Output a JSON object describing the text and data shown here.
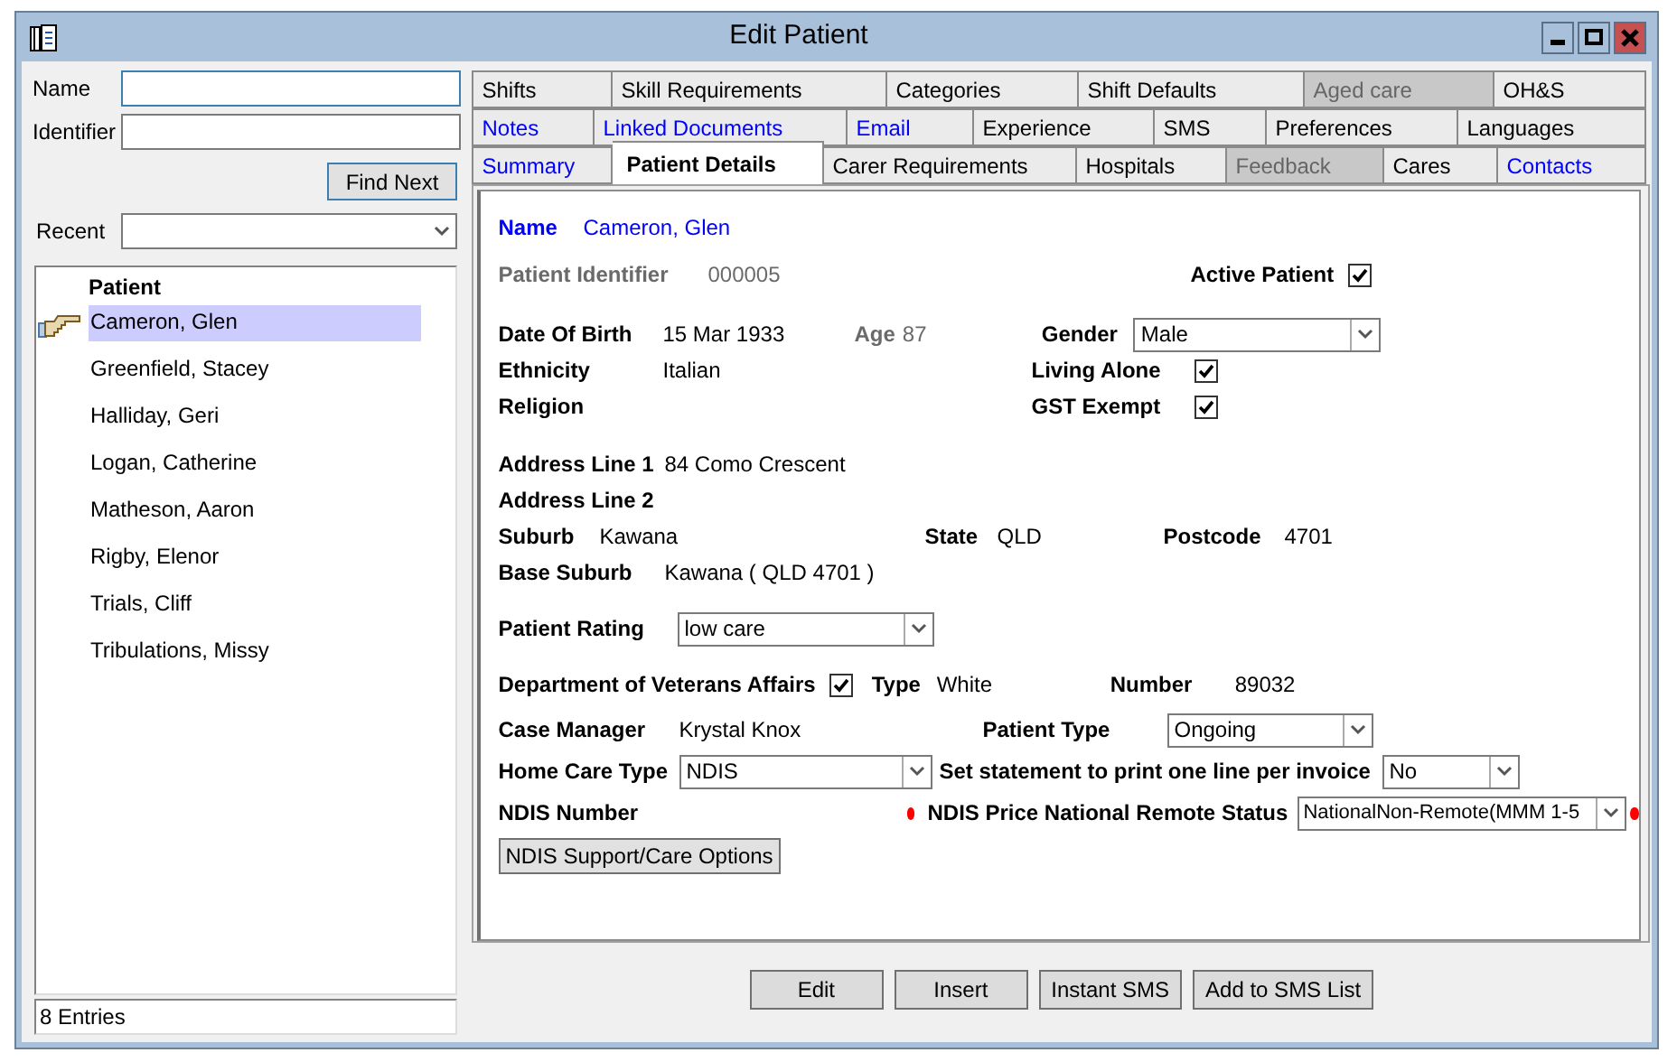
{
  "window": {
    "title": "Edit Patient"
  },
  "search": {
    "name_label": "Name",
    "identifier_label": "Identifier",
    "find_button": "Find Next",
    "recent_label": "Recent"
  },
  "patient_list": {
    "header": "Patient",
    "footer": "8 Entries",
    "items": [
      {
        "name": "Cameron, Glen",
        "selected": true
      },
      {
        "name": "Greenfield, Stacey",
        "selected": false
      },
      {
        "name": "Halliday, Geri",
        "selected": false
      },
      {
        "name": "Logan, Catherine",
        "selected": false
      },
      {
        "name": "Matheson, Aaron",
        "selected": false
      },
      {
        "name": "Rigby, Elenor",
        "selected": false
      },
      {
        "name": "Trials, Cliff",
        "selected": false
      },
      {
        "name": "Tribulations, Missy",
        "selected": false
      }
    ]
  },
  "tabs": [
    [
      {
        "label": "Shifts",
        "kind": "plain",
        "disabled": false,
        "selected": false
      },
      {
        "label": "Skill Requirements",
        "kind": "plain",
        "disabled": false,
        "selected": false
      },
      {
        "label": "Categories",
        "kind": "plain",
        "disabled": false,
        "selected": false
      },
      {
        "label": "Shift Defaults",
        "kind": "plain",
        "disabled": false,
        "selected": false
      },
      {
        "label": "Aged care",
        "kind": "plain",
        "disabled": true,
        "selected": false
      },
      {
        "label": "OH&S",
        "kind": "plain",
        "disabled": false,
        "selected": false
      }
    ],
    [
      {
        "label": "Notes",
        "kind": "link",
        "disabled": false,
        "selected": false
      },
      {
        "label": "Linked Documents",
        "kind": "link",
        "disabled": false,
        "selected": false
      },
      {
        "label": "Email",
        "kind": "link",
        "disabled": false,
        "selected": false
      },
      {
        "label": "Experience",
        "kind": "plain",
        "disabled": false,
        "selected": false
      },
      {
        "label": "SMS",
        "kind": "plain",
        "disabled": false,
        "selected": false
      },
      {
        "label": "Preferences",
        "kind": "plain",
        "disabled": false,
        "selected": false
      },
      {
        "label": "Languages",
        "kind": "plain",
        "disabled": false,
        "selected": false
      }
    ],
    [
      {
        "label": "Summary",
        "kind": "link",
        "disabled": false,
        "selected": false
      },
      {
        "label": "Patient Details",
        "kind": "plain",
        "disabled": false,
        "selected": true
      },
      {
        "label": "Carer Requirements",
        "kind": "plain",
        "disabled": false,
        "selected": false
      },
      {
        "label": "Hospitals",
        "kind": "plain",
        "disabled": false,
        "selected": false
      },
      {
        "label": "Feedback",
        "kind": "plain",
        "disabled": true,
        "selected": false
      },
      {
        "label": "Cares",
        "kind": "plain",
        "disabled": false,
        "selected": false
      },
      {
        "label": "Contacts",
        "kind": "link",
        "disabled": false,
        "selected": false
      }
    ]
  ],
  "details": {
    "name": {
      "label": "Name",
      "value": "Cameron, Glen"
    },
    "identifier": {
      "label": "Patient Identifier",
      "value": "000005"
    },
    "active_patient": {
      "label": "Active Patient",
      "checked": true
    },
    "date_of_birth": {
      "label": "Date Of Birth",
      "value": "15 Mar 1933"
    },
    "age": {
      "label": "Age",
      "value": "87"
    },
    "gender": {
      "label": "Gender",
      "value": "Male"
    },
    "ethnicity": {
      "label": "Ethnicity",
      "value": "Italian"
    },
    "living_alone": {
      "label": "Living Alone",
      "checked": true
    },
    "religion": {
      "label": "Religion"
    },
    "gst_exempt": {
      "label": "GST Exempt",
      "checked": true
    },
    "address_line_1": {
      "label": "Address Line 1",
      "value": "84 Como Crescent"
    },
    "address_line_2": {
      "label": "Address Line 2"
    },
    "suburb": {
      "label": "Suburb",
      "value": "Kawana"
    },
    "state": {
      "label": "State",
      "value": "QLD"
    },
    "postcode": {
      "label": "Postcode",
      "value": "4701"
    },
    "base_suburb": {
      "label": "Base Suburb",
      "value": "Kawana  ( QLD 4701 )"
    },
    "patient_rating": {
      "label": "Patient Rating",
      "value": "low care"
    },
    "veterans_affairs": {
      "label": "Department of Veterans Affairs",
      "checked": true
    },
    "type": {
      "label": "Type",
      "value": "White"
    },
    "number": {
      "label": "Number",
      "value": "89032"
    },
    "case_manager": {
      "label": "Case Manager",
      "value": "Krystal Knox"
    },
    "patient_type": {
      "label": "Patient Type",
      "value": "Ongoing"
    },
    "home_care_type": {
      "label": "Home Care Type",
      "value": "NDIS"
    },
    "statement": {
      "label": "Set statement to print one line per invoice",
      "value": "No"
    },
    "ndis_number": {
      "label": "NDIS Number",
      "required": true
    },
    "ndis_price": {
      "label": "NDIS Price National Remote Status",
      "value": "NationalNon-Remote(MMM 1-5",
      "required": true
    },
    "ndis_options_button": "NDIS Support/Care Options"
  },
  "actions": [
    "Edit",
    "Insert",
    "Instant SMS",
    "Add to SMS List"
  ]
}
